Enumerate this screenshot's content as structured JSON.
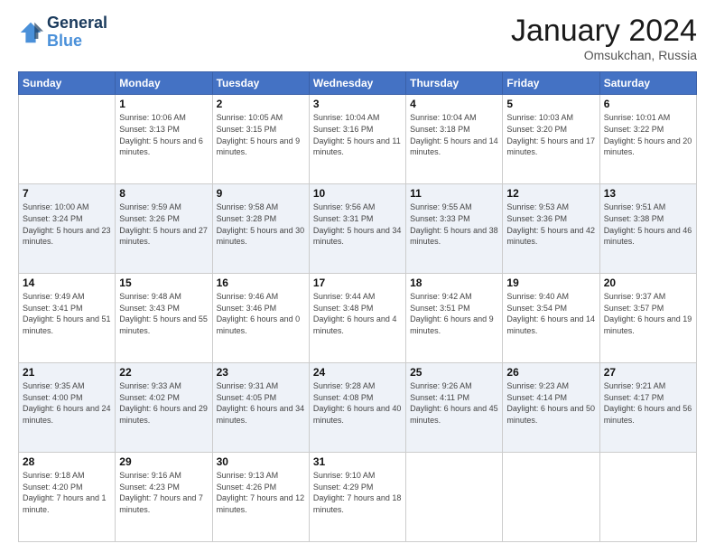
{
  "logo": {
    "text_general": "General",
    "text_blue": "Blue"
  },
  "header": {
    "month": "January 2024",
    "location": "Omsukchan, Russia"
  },
  "days_of_week": [
    "Sunday",
    "Monday",
    "Tuesday",
    "Wednesday",
    "Thursday",
    "Friday",
    "Saturday"
  ],
  "weeks": [
    [
      {
        "day": "",
        "sunrise": "",
        "sunset": "",
        "daylight": ""
      },
      {
        "day": "1",
        "sunrise": "Sunrise: 10:06 AM",
        "sunset": "Sunset: 3:13 PM",
        "daylight": "Daylight: 5 hours and 6 minutes."
      },
      {
        "day": "2",
        "sunrise": "Sunrise: 10:05 AM",
        "sunset": "Sunset: 3:15 PM",
        "daylight": "Daylight: 5 hours and 9 minutes."
      },
      {
        "day": "3",
        "sunrise": "Sunrise: 10:04 AM",
        "sunset": "Sunset: 3:16 PM",
        "daylight": "Daylight: 5 hours and 11 minutes."
      },
      {
        "day": "4",
        "sunrise": "Sunrise: 10:04 AM",
        "sunset": "Sunset: 3:18 PM",
        "daylight": "Daylight: 5 hours and 14 minutes."
      },
      {
        "day": "5",
        "sunrise": "Sunrise: 10:03 AM",
        "sunset": "Sunset: 3:20 PM",
        "daylight": "Daylight: 5 hours and 17 minutes."
      },
      {
        "day": "6",
        "sunrise": "Sunrise: 10:01 AM",
        "sunset": "Sunset: 3:22 PM",
        "daylight": "Daylight: 5 hours and 20 minutes."
      }
    ],
    [
      {
        "day": "7",
        "sunrise": "Sunrise: 10:00 AM",
        "sunset": "Sunset: 3:24 PM",
        "daylight": "Daylight: 5 hours and 23 minutes."
      },
      {
        "day": "8",
        "sunrise": "Sunrise: 9:59 AM",
        "sunset": "Sunset: 3:26 PM",
        "daylight": "Daylight: 5 hours and 27 minutes."
      },
      {
        "day": "9",
        "sunrise": "Sunrise: 9:58 AM",
        "sunset": "Sunset: 3:28 PM",
        "daylight": "Daylight: 5 hours and 30 minutes."
      },
      {
        "day": "10",
        "sunrise": "Sunrise: 9:56 AM",
        "sunset": "Sunset: 3:31 PM",
        "daylight": "Daylight: 5 hours and 34 minutes."
      },
      {
        "day": "11",
        "sunrise": "Sunrise: 9:55 AM",
        "sunset": "Sunset: 3:33 PM",
        "daylight": "Daylight: 5 hours and 38 minutes."
      },
      {
        "day": "12",
        "sunrise": "Sunrise: 9:53 AM",
        "sunset": "Sunset: 3:36 PM",
        "daylight": "Daylight: 5 hours and 42 minutes."
      },
      {
        "day": "13",
        "sunrise": "Sunrise: 9:51 AM",
        "sunset": "Sunset: 3:38 PM",
        "daylight": "Daylight: 5 hours and 46 minutes."
      }
    ],
    [
      {
        "day": "14",
        "sunrise": "Sunrise: 9:49 AM",
        "sunset": "Sunset: 3:41 PM",
        "daylight": "Daylight: 5 hours and 51 minutes."
      },
      {
        "day": "15",
        "sunrise": "Sunrise: 9:48 AM",
        "sunset": "Sunset: 3:43 PM",
        "daylight": "Daylight: 5 hours and 55 minutes."
      },
      {
        "day": "16",
        "sunrise": "Sunrise: 9:46 AM",
        "sunset": "Sunset: 3:46 PM",
        "daylight": "Daylight: 6 hours and 0 minutes."
      },
      {
        "day": "17",
        "sunrise": "Sunrise: 9:44 AM",
        "sunset": "Sunset: 3:48 PM",
        "daylight": "Daylight: 6 hours and 4 minutes."
      },
      {
        "day": "18",
        "sunrise": "Sunrise: 9:42 AM",
        "sunset": "Sunset: 3:51 PM",
        "daylight": "Daylight: 6 hours and 9 minutes."
      },
      {
        "day": "19",
        "sunrise": "Sunrise: 9:40 AM",
        "sunset": "Sunset: 3:54 PM",
        "daylight": "Daylight: 6 hours and 14 minutes."
      },
      {
        "day": "20",
        "sunrise": "Sunrise: 9:37 AM",
        "sunset": "Sunset: 3:57 PM",
        "daylight": "Daylight: 6 hours and 19 minutes."
      }
    ],
    [
      {
        "day": "21",
        "sunrise": "Sunrise: 9:35 AM",
        "sunset": "Sunset: 4:00 PM",
        "daylight": "Daylight: 6 hours and 24 minutes."
      },
      {
        "day": "22",
        "sunrise": "Sunrise: 9:33 AM",
        "sunset": "Sunset: 4:02 PM",
        "daylight": "Daylight: 6 hours and 29 minutes."
      },
      {
        "day": "23",
        "sunrise": "Sunrise: 9:31 AM",
        "sunset": "Sunset: 4:05 PM",
        "daylight": "Daylight: 6 hours and 34 minutes."
      },
      {
        "day": "24",
        "sunrise": "Sunrise: 9:28 AM",
        "sunset": "Sunset: 4:08 PM",
        "daylight": "Daylight: 6 hours and 40 minutes."
      },
      {
        "day": "25",
        "sunrise": "Sunrise: 9:26 AM",
        "sunset": "Sunset: 4:11 PM",
        "daylight": "Daylight: 6 hours and 45 minutes."
      },
      {
        "day": "26",
        "sunrise": "Sunrise: 9:23 AM",
        "sunset": "Sunset: 4:14 PM",
        "daylight": "Daylight: 6 hours and 50 minutes."
      },
      {
        "day": "27",
        "sunrise": "Sunrise: 9:21 AM",
        "sunset": "Sunset: 4:17 PM",
        "daylight": "Daylight: 6 hours and 56 minutes."
      }
    ],
    [
      {
        "day": "28",
        "sunrise": "Sunrise: 9:18 AM",
        "sunset": "Sunset: 4:20 PM",
        "daylight": "Daylight: 7 hours and 1 minute."
      },
      {
        "day": "29",
        "sunrise": "Sunrise: 9:16 AM",
        "sunset": "Sunset: 4:23 PM",
        "daylight": "Daylight: 7 hours and 7 minutes."
      },
      {
        "day": "30",
        "sunrise": "Sunrise: 9:13 AM",
        "sunset": "Sunset: 4:26 PM",
        "daylight": "Daylight: 7 hours and 12 minutes."
      },
      {
        "day": "31",
        "sunrise": "Sunrise: 9:10 AM",
        "sunset": "Sunset: 4:29 PM",
        "daylight": "Daylight: 7 hours and 18 minutes."
      },
      {
        "day": "",
        "sunrise": "",
        "sunset": "",
        "daylight": ""
      },
      {
        "day": "",
        "sunrise": "",
        "sunset": "",
        "daylight": ""
      },
      {
        "day": "",
        "sunrise": "",
        "sunset": "",
        "daylight": ""
      }
    ]
  ]
}
